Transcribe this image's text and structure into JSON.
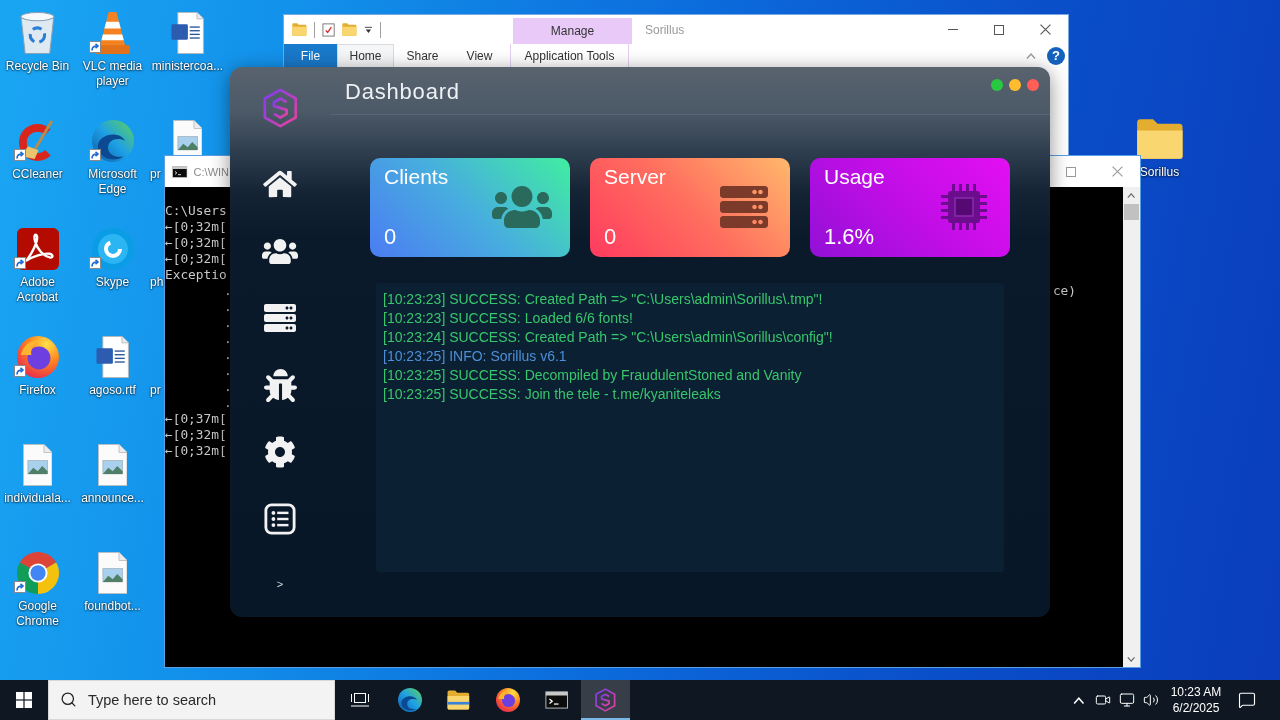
{
  "desktop": {
    "icons": [
      {
        "label": "Recycle Bin",
        "kind": "recycle-bin",
        "shortcut": false,
        "cut": false
      },
      {
        "label": "CCleaner",
        "kind": "ccleaner",
        "shortcut": true,
        "cut": false
      },
      {
        "label": "Adobe Acrobat",
        "kind": "acrobat",
        "shortcut": true,
        "cut": false
      },
      {
        "label": "Firefox",
        "kind": "firefox",
        "shortcut": true,
        "cut": false
      },
      {
        "label": "individuala...",
        "kind": "image-file",
        "shortcut": false,
        "cut": false
      },
      {
        "label": "Google Chrome",
        "kind": "chrome",
        "shortcut": true,
        "cut": false
      },
      {
        "label": "VLC media player",
        "kind": "vlc",
        "shortcut": true,
        "cut": false
      },
      {
        "label": "Microsoft Edge",
        "kind": "edge",
        "shortcut": true,
        "cut": false
      },
      {
        "label": "Skype",
        "kind": "skype",
        "shortcut": true,
        "cut": false
      },
      {
        "label": "agoso.rtf",
        "kind": "word-doc",
        "shortcut": false,
        "cut": false
      },
      {
        "label": "announce...",
        "kind": "image-file",
        "shortcut": false,
        "cut": false
      },
      {
        "label": "foundbot...",
        "kind": "image-file",
        "shortcut": false,
        "cut": false
      },
      {
        "label": "ministercoa...",
        "kind": "word-doc",
        "shortcut": false,
        "cut": false
      },
      {
        "label": "pr",
        "kind": "image-file",
        "shortcut": false,
        "cut": true
      },
      {
        "label": "ph",
        "shortcut": false,
        "cut": true
      },
      {
        "label": "pr",
        "shortcut": false,
        "cut": true
      }
    ],
    "folder": {
      "label": "Sorillus",
      "kind": "folder"
    }
  },
  "explorer": {
    "title": "Sorillus",
    "context_group": "Manage",
    "tabs": [
      {
        "label": "File",
        "kind": "file",
        "selected": false
      },
      {
        "label": "Home",
        "kind": "tab",
        "selected": true
      },
      {
        "label": "Share",
        "kind": "tab",
        "selected": false
      },
      {
        "label": "View",
        "kind": "tab",
        "selected": false
      },
      {
        "label": "Application Tools",
        "kind": "context",
        "selected": false
      }
    ],
    "help": "?"
  },
  "console": {
    "title": "C:\\WIN",
    "lines": [
      {
        "text": "C:\\Users",
        "kind": "line"
      },
      {
        "text": "←[0;32m[",
        "kind": "line"
      },
      {
        "text": "←[0;32m[",
        "kind": "line"
      },
      {
        "text": "←[0;32m[",
        "kind": "line"
      },
      {
        "text": "Exceptio",
        "kind": "line"
      },
      {
        "text": ".",
        "kind": "indented",
        "tail": "ce)"
      },
      {
        "text": ".",
        "kind": "indented"
      },
      {
        "text": ".",
        "kind": "indented"
      },
      {
        "text": ".",
        "kind": "indented"
      },
      {
        "text": ".",
        "kind": "indented"
      },
      {
        "text": ".",
        "kind": "indented"
      },
      {
        "text": ".",
        "kind": "indented"
      },
      {
        "text": ".",
        "kind": "indented"
      },
      {
        "text": "←[0;37m[",
        "kind": "line"
      },
      {
        "text": "←[0;32m[",
        "kind": "line"
      },
      {
        "text": "←[0;32m[",
        "kind": "line"
      }
    ]
  },
  "app": {
    "title": "Dashboard",
    "window_controls": [
      {
        "color": "#28c840"
      },
      {
        "color": "#febc2e"
      },
      {
        "color": "#ff5f57"
      }
    ],
    "sidebar": {
      "items": [
        {
          "kind": "home"
        },
        {
          "kind": "clients"
        },
        {
          "kind": "servers"
        },
        {
          "kind": "bug"
        },
        {
          "kind": "settings"
        },
        {
          "kind": "logs"
        }
      ],
      "expand": ">"
    },
    "cards": [
      {
        "title": "Clients",
        "value": "0",
        "kind": "clients"
      },
      {
        "title": "Server",
        "value": "0",
        "kind": "server"
      },
      {
        "title": "Usage",
        "value": "1.6%",
        "kind": "usage"
      }
    ],
    "log": [
      {
        "text": "[10:23:23] SUCCESS: Created Path => \"C:\\Users\\admin\\Sorillus\\.tmp\"!",
        "kind": "success"
      },
      {
        "text": "[10:23:23] SUCCESS: Loaded 6/6 fonts!",
        "kind": "success"
      },
      {
        "text": "[10:23:24] SUCCESS: Created Path => \"C:\\Users\\admin\\Sorillus\\config\"!",
        "kind": "success"
      },
      {
        "text": "[10:23:25] INFO: Sorillus v6.1",
        "kind": "info"
      },
      {
        "text": "[10:23:25] SUCCESS: Decompiled by FraudulentStoned and Vanity",
        "kind": "success"
      },
      {
        "text": "[10:23:25] SUCCESS: Join the tele - t.me/kyaniteleaks",
        "kind": "success"
      }
    ]
  },
  "taskbar": {
    "search": {
      "placeholder": "Type here to search"
    },
    "apps": [
      {
        "kind": "edge",
        "selected": false
      },
      {
        "kind": "explorer",
        "selected": false
      },
      {
        "kind": "firefox",
        "selected": false
      },
      {
        "kind": "terminal",
        "selected": false
      },
      {
        "kind": "sorillus",
        "selected": true
      }
    ],
    "clock": {
      "time": "10:23 AM",
      "date": "6/2/2025"
    }
  }
}
